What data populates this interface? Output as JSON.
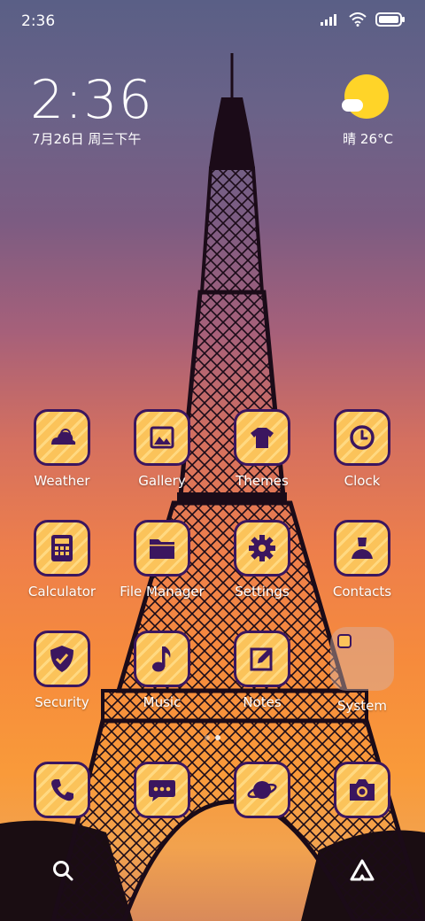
{
  "status_bar": {
    "time": "2:36",
    "icons": [
      "signal-icon",
      "wifi-icon",
      "battery-icon"
    ]
  },
  "clock_widget": {
    "time": "2:36",
    "date": "7月26日 周三下午"
  },
  "weather_widget": {
    "text": "晴 26°C",
    "icon": "sunny-partly-cloudy-icon"
  },
  "apps": [
    {
      "label": "Weather",
      "icon": "weather-icon"
    },
    {
      "label": "Gallery",
      "icon": "gallery-icon"
    },
    {
      "label": "Themes",
      "icon": "themes-icon"
    },
    {
      "label": "Clock",
      "icon": "clock-icon"
    },
    {
      "label": "Calculator",
      "icon": "calculator-icon"
    },
    {
      "label": "File Manager",
      "icon": "folder-icon"
    },
    {
      "label": "Settings",
      "icon": "gear-icon"
    },
    {
      "label": "Contacts",
      "icon": "contacts-icon"
    },
    {
      "label": "Security",
      "icon": "shield-icon"
    },
    {
      "label": "Music",
      "icon": "music-note-icon"
    },
    {
      "label": "Notes",
      "icon": "notes-icon"
    },
    {
      "label": "System",
      "icon": "folder-icon"
    }
  ],
  "dock": [
    {
      "icon": "phone-icon"
    },
    {
      "icon": "messages-icon"
    },
    {
      "icon": "browser-icon"
    },
    {
      "icon": "camera-icon"
    }
  ],
  "page_indicator": {
    "current": 2,
    "total": 2
  },
  "bottom_bar": {
    "left_icon": "search-icon",
    "right_icon": "assistant-icon"
  },
  "colors": {
    "icon_tile": "#fbc35a",
    "icon_border": "#3b165f",
    "icon_glyph": "#3b165f",
    "sun": "#ffd428"
  }
}
